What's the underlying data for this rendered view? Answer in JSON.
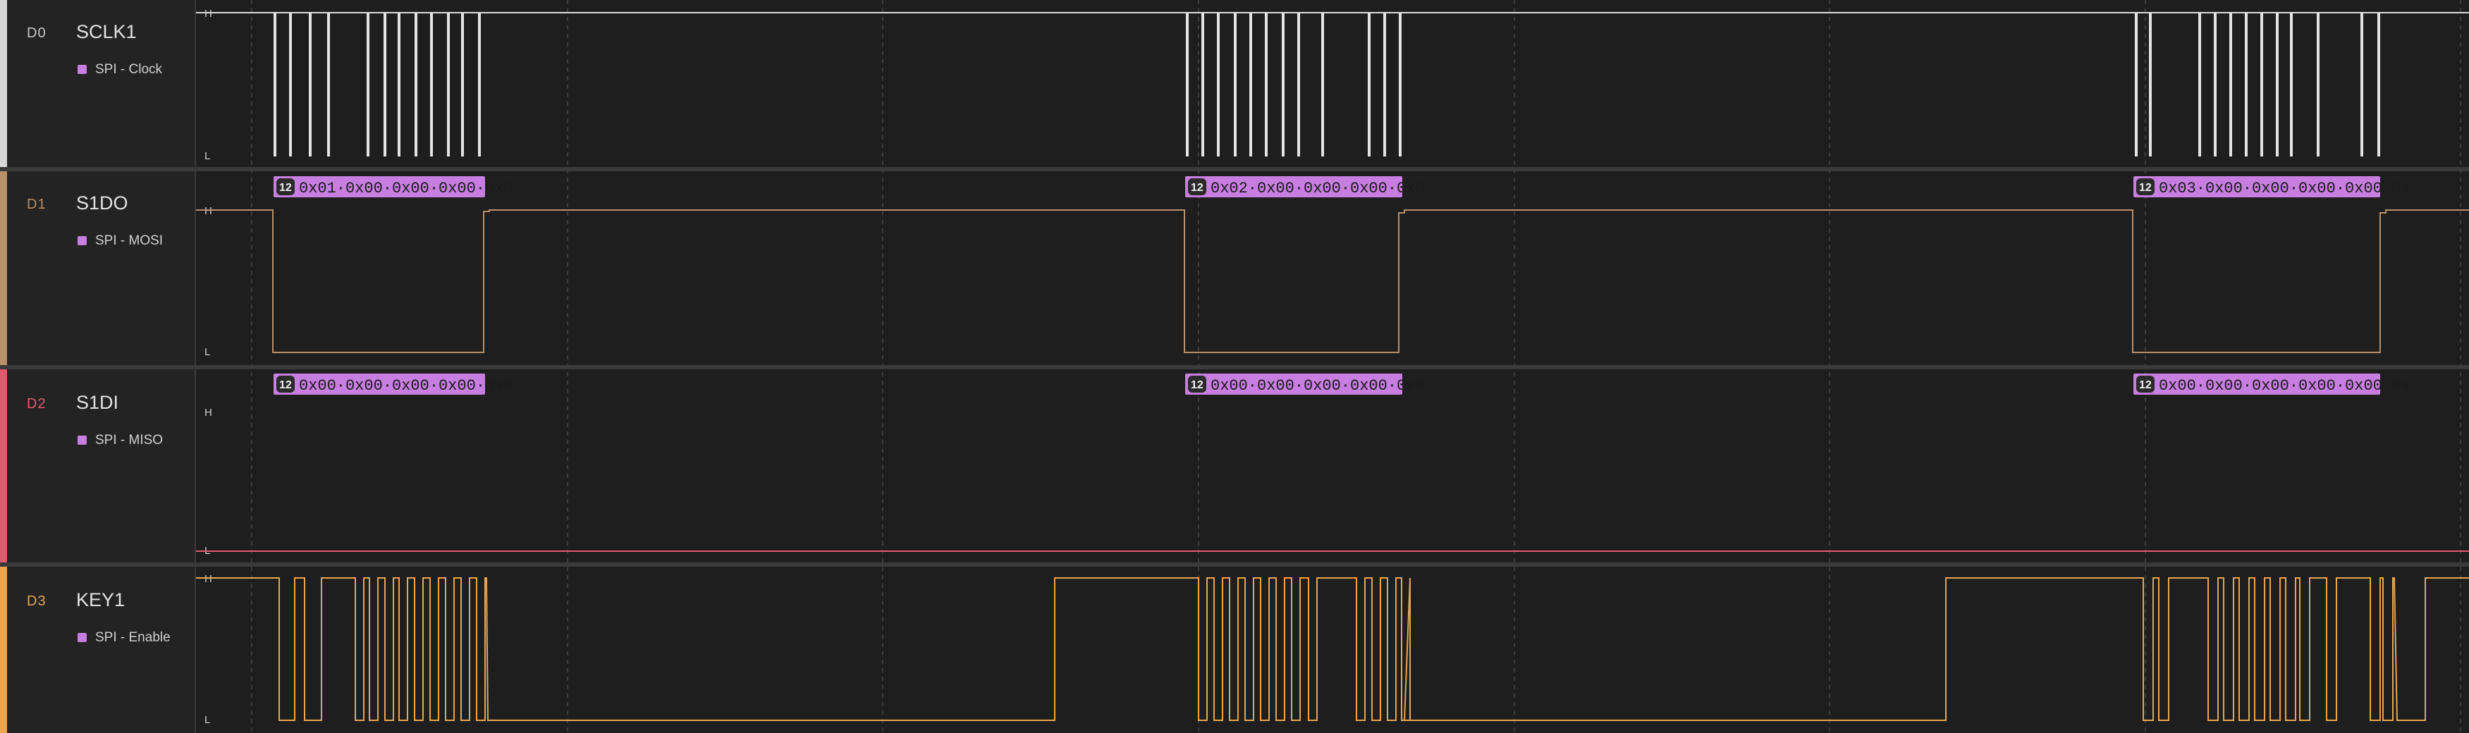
{
  "channels": [
    {
      "id": "D0",
      "name": "SCLK1",
      "analyzer": "SPI - Clock",
      "color": "#d7d7d7",
      "id_color": "#c8c8c8"
    },
    {
      "id": "D1",
      "name": "S1DO",
      "analyzer": "SPI - MOSI",
      "color": "#b8906a",
      "id_color": "#b8906a"
    },
    {
      "id": "D2",
      "name": "S1DI",
      "analyzer": "SPI - MISO",
      "color": "#e05a6e",
      "id_color": "#e05a6e"
    },
    {
      "id": "D3",
      "name": "KEY1",
      "analyzer": "SPI - Enable",
      "color": "#e8a64e",
      "id_color": "#e8a64e"
    }
  ],
  "levels": {
    "high": "H",
    "low": "L"
  },
  "colors": {
    "decoded_bg": "#c77ee0",
    "grid": "#3c3c3c",
    "separator": "#3a3a3a",
    "background": "#1e1e1e"
  },
  "decoded": {
    "mosi": [
      {
        "badge": "12",
        "text": "0x01·0x00·0x00·0x00·0x0"
      },
      {
        "badge": "12",
        "text": "0x02·0x00·0x00·0x00·0x0"
      },
      {
        "badge": "12",
        "text": "0x03·0x00·0x00·0x00·0x00·0x"
      }
    ],
    "miso": [
      {
        "badge": "12",
        "text": "0x00·0x00·0x00·0x00·0x0"
      },
      {
        "badge": "12",
        "text": "0x00·0x00·0x00·0x00·0x0"
      },
      {
        "badge": "12",
        "text": "0x00·0x00·0x00·0x00·0x00·0x"
      }
    ]
  }
}
